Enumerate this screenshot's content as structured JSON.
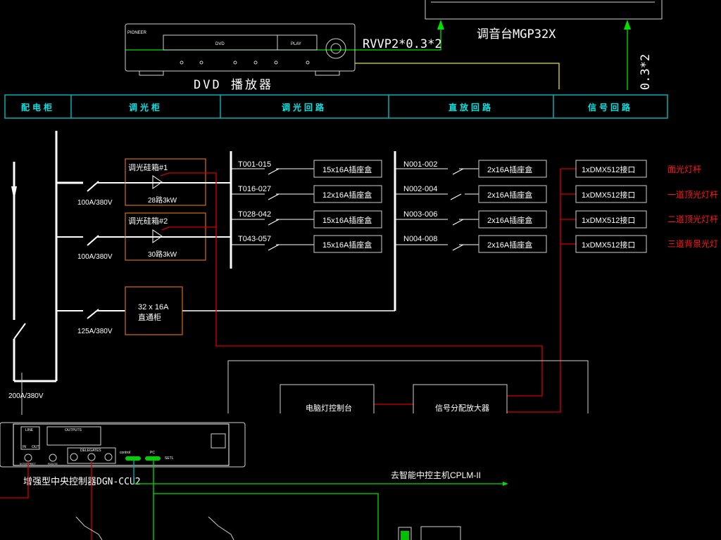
{
  "colors": {
    "background": "#000000",
    "header": "#00e5e5",
    "signal": "#d40000",
    "audio": "#00e000",
    "dimmer_box": "#c8660a",
    "yellow_line": "#e6e600"
  },
  "top": {
    "mixer_label": "调音台MGP32X",
    "cable_label": "RVVP2*0.3*2",
    "cable_label_vertical": "0.3*2",
    "dvd_label": "DVD 播放器",
    "dvd_brand": "PIONEER",
    "dvd_tray": "DVD",
    "dvd_play": "PLAY"
  },
  "header": [
    "配电柜",
    "调光柜",
    "调光回路",
    "直放回路",
    "信号回路"
  ],
  "power": {
    "main_breaker": "200A/380V",
    "branches": [
      {
        "breaker": "100A/380V",
        "box_title": "调光硅箱#1",
        "box_spec": "28路3kW"
      },
      {
        "breaker": "100A/380V",
        "box_title": "调光硅箱#2",
        "box_spec": "30路3kW"
      },
      {
        "breaker": "125A/380V",
        "box_title": "32 x 16A",
        "box_spec": "直通柜"
      }
    ]
  },
  "dimmer_circuits": [
    {
      "id": "T001-015",
      "box": "15x16A插座盒"
    },
    {
      "id": "T016-027",
      "box": "12x16A插座盒"
    },
    {
      "id": "T028-042",
      "box": "15x16A插座盒"
    },
    {
      "id": "T043-057",
      "box": "15x16A插座盒"
    }
  ],
  "direct_circuits": [
    {
      "id": "N001-002",
      "box": "2x16A插座盒"
    },
    {
      "id": "N002-004",
      "box": "2x16A插座盒"
    },
    {
      "id": "N003-006",
      "box": "2x16A插座盒"
    },
    {
      "id": "N004-008",
      "box": "2x16A插座盒"
    }
  ],
  "signal_circuits": [
    {
      "box": "1xDMX512接口",
      "target": "面光灯杆"
    },
    {
      "box": "1xDMX512接口",
      "target": "一道顶光灯杆"
    },
    {
      "box": "1xDMX512接口",
      "target": "二道顶光灯杆"
    },
    {
      "box": "1xDMX512接口",
      "target": "三道背景光灯"
    }
  ],
  "control": {
    "console": "电脑灯控制台",
    "amplifier": "信号分配放大器"
  },
  "ccu": {
    "label": "增强型中央控制器DGN-CCU2",
    "line": "LINE",
    "in": "IN",
    "out": "OUT",
    "outputs": "OUTPUTS",
    "delegates": "DELEGATES",
    "interpret": "INTERPRET",
    "route": "ROUTE",
    "control": "control",
    "pc": "PC",
    "setl": "SETL",
    "to_host": "去智能中控主机CPLM-II"
  }
}
